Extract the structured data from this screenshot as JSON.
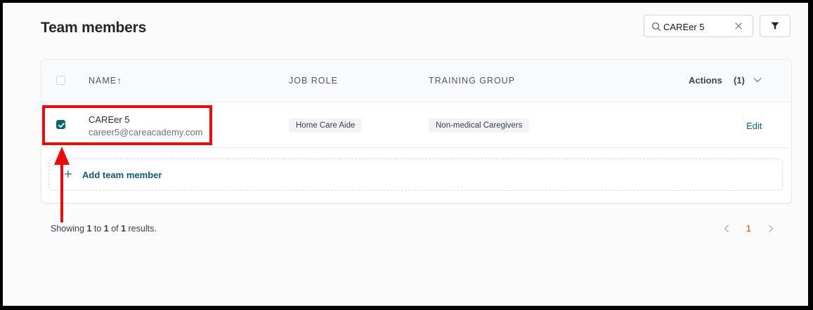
{
  "header": {
    "title": "Team members"
  },
  "search": {
    "value": "CAREer 5"
  },
  "table": {
    "columns": {
      "name": "NAME↑",
      "job_role": "JOB ROLE",
      "training_group": "TRAINING GROUP"
    },
    "actions": {
      "label": "Actions",
      "count": "(1)"
    },
    "rows": [
      {
        "name": "CAREer 5",
        "email": "career5@careacademy.com",
        "job_role": "Home Care Aide",
        "training_group": "Non-medical Caregivers",
        "edit_label": "Edit",
        "selected": true
      }
    ],
    "add_member_label": "Add team member"
  },
  "footer": {
    "results_prefix": "Showing ",
    "results_from": "1",
    "results_to_word": " to ",
    "results_to": "1",
    "results_of_word": " of ",
    "results_total": "1",
    "results_suffix": " results.",
    "current_page": "1"
  },
  "colors": {
    "accent": "#0e6577",
    "annotation": "#ee0a0a",
    "current_page": "#c2410c"
  },
  "icons": [
    "search-icon",
    "close-icon",
    "filter-icon",
    "chevron-down-icon",
    "check-icon",
    "plus-icon",
    "chevron-left-icon",
    "chevron-right-icon",
    "arrow-up-icon"
  ]
}
